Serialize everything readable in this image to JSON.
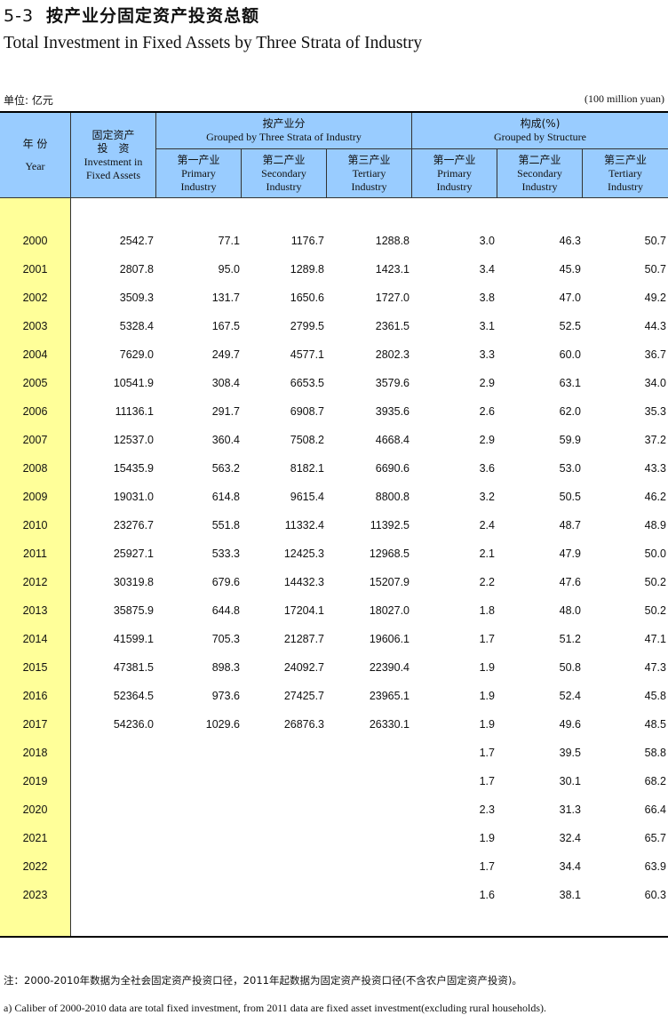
{
  "title": {
    "number": "5-3",
    "cn": "按产业分固定资产投资总额",
    "en": "Total Investment in Fixed Assets by Three Strata of Industry"
  },
  "unit": {
    "cn": "单位: 亿元",
    "en": "(100 million yuan)"
  },
  "header": {
    "year_cn": "年 份",
    "year_en": "Year",
    "total_cn1": "固定资产",
    "total_cn2": "投　资",
    "total_en1": "Investment in",
    "total_en2": "Fixed Assets",
    "group1_cn": "按产业分",
    "group1_en": "Grouped by Three Strata of Industry",
    "group2_cn": "构成(%)",
    "group2_en": "Grouped by Structure",
    "primary_cn": "第一产业",
    "primary_en1": "Primary",
    "primary_en2": "Industry",
    "secondary_cn": "第二产业",
    "secondary_en1": "Secondary",
    "secondary_en2": "Industry",
    "tertiary_cn": "第三产业",
    "tertiary_en1": "Tertiary",
    "tertiary_en2": "Industry"
  },
  "rows": [
    {
      "year": "2000",
      "total": "2542.7",
      "p1": "77.1",
      "p2": "1176.7",
      "p3": "1288.8",
      "s1": "3.0",
      "s2": "46.3",
      "s3": "50.7"
    },
    {
      "year": "2001",
      "total": "2807.8",
      "p1": "95.0",
      "p2": "1289.8",
      "p3": "1423.1",
      "s1": "3.4",
      "s2": "45.9",
      "s3": "50.7"
    },
    {
      "year": "2002",
      "total": "3509.3",
      "p1": "131.7",
      "p2": "1650.6",
      "p3": "1727.0",
      "s1": "3.8",
      "s2": "47.0",
      "s3": "49.2"
    },
    {
      "year": "2003",
      "total": "5328.4",
      "p1": "167.5",
      "p2": "2799.5",
      "p3": "2361.5",
      "s1": "3.1",
      "s2": "52.5",
      "s3": "44.3"
    },
    {
      "year": "2004",
      "total": "7629.0",
      "p1": "249.7",
      "p2": "4577.1",
      "p3": "2802.3",
      "s1": "3.3",
      "s2": "60.0",
      "s3": "36.7"
    },
    {
      "year": "2005",
      "total": "10541.9",
      "p1": "308.4",
      "p2": "6653.5",
      "p3": "3579.6",
      "s1": "2.9",
      "s2": "63.1",
      "s3": "34.0"
    },
    {
      "year": "2006",
      "total": "11136.1",
      "p1": "291.7",
      "p2": "6908.7",
      "p3": "3935.6",
      "s1": "2.6",
      "s2": "62.0",
      "s3": "35.3"
    },
    {
      "year": "2007",
      "total": "12537.0",
      "p1": "360.4",
      "p2": "7508.2",
      "p3": "4668.4",
      "s1": "2.9",
      "s2": "59.9",
      "s3": "37.2"
    },
    {
      "year": "2008",
      "total": "15435.9",
      "p1": "563.2",
      "p2": "8182.1",
      "p3": "6690.6",
      "s1": "3.6",
      "s2": "53.0",
      "s3": "43.3"
    },
    {
      "year": "2009",
      "total": "19031.0",
      "p1": "614.8",
      "p2": "9615.4",
      "p3": "8800.8",
      "s1": "3.2",
      "s2": "50.5",
      "s3": "46.2"
    },
    {
      "year": "2010",
      "total": "23276.7",
      "p1": "551.8",
      "p2": "11332.4",
      "p3": "11392.5",
      "s1": "2.4",
      "s2": "48.7",
      "s3": "48.9"
    },
    {
      "year": "2011",
      "total": "25927.1",
      "p1": "533.3",
      "p2": "12425.3",
      "p3": "12968.5",
      "s1": "2.1",
      "s2": "47.9",
      "s3": "50.0"
    },
    {
      "year": "2012",
      "total": "30319.8",
      "p1": "679.6",
      "p2": "14432.3",
      "p3": "15207.9",
      "s1": "2.2",
      "s2": "47.6",
      "s3": "50.2"
    },
    {
      "year": "2013",
      "total": "35875.9",
      "p1": "644.8",
      "p2": "17204.1",
      "p3": "18027.0",
      "s1": "1.8",
      "s2": "48.0",
      "s3": "50.2"
    },
    {
      "year": "2014",
      "total": "41599.1",
      "p1": "705.3",
      "p2": "21287.7",
      "p3": "19606.1",
      "s1": "1.7",
      "s2": "51.2",
      "s3": "47.1"
    },
    {
      "year": "2015",
      "total": "47381.5",
      "p1": "898.3",
      "p2": "24092.7",
      "p3": "22390.4",
      "s1": "1.9",
      "s2": "50.8",
      "s3": "47.3"
    },
    {
      "year": "2016",
      "total": "52364.5",
      "p1": "973.6",
      "p2": "27425.7",
      "p3": "23965.1",
      "s1": "1.9",
      "s2": "52.4",
      "s3": "45.8"
    },
    {
      "year": "2017",
      "total": "54236.0",
      "p1": "1029.6",
      "p2": "26876.3",
      "p3": "26330.1",
      "s1": "1.9",
      "s2": "49.6",
      "s3": "48.5"
    },
    {
      "year": "2018",
      "total": "",
      "p1": "",
      "p2": "",
      "p3": "",
      "s1": "1.7",
      "s2": "39.5",
      "s3": "58.8"
    },
    {
      "year": "2019",
      "total": "",
      "p1": "",
      "p2": "",
      "p3": "",
      "s1": "1.7",
      "s2": "30.1",
      "s3": "68.2"
    },
    {
      "year": "2020",
      "total": "",
      "p1": "",
      "p2": "",
      "p3": "",
      "s1": "2.3",
      "s2": "31.3",
      "s3": "66.4"
    },
    {
      "year": "2021",
      "total": "",
      "p1": "",
      "p2": "",
      "p3": "",
      "s1": "1.9",
      "s2": "32.4",
      "s3": "65.7"
    },
    {
      "year": "2022",
      "total": "",
      "p1": "",
      "p2": "",
      "p3": "",
      "s1": "1.7",
      "s2": "34.4",
      "s3": "63.9"
    },
    {
      "year": "2023",
      "total": "",
      "p1": "",
      "p2": "",
      "p3": "",
      "s1": "1.6",
      "s2": "38.1",
      "s3": "60.3"
    }
  ],
  "notes": {
    "cn": "注：2000-2010年数据为全社会固定资产投资口径，2011年起数据为固定资产投资口径(不含农户固定资产投资)。",
    "en": "a) Caliber of 2000-2010 data are total fixed investment, from 2011 data are fixed asset investment(excluding rural households)."
  }
}
